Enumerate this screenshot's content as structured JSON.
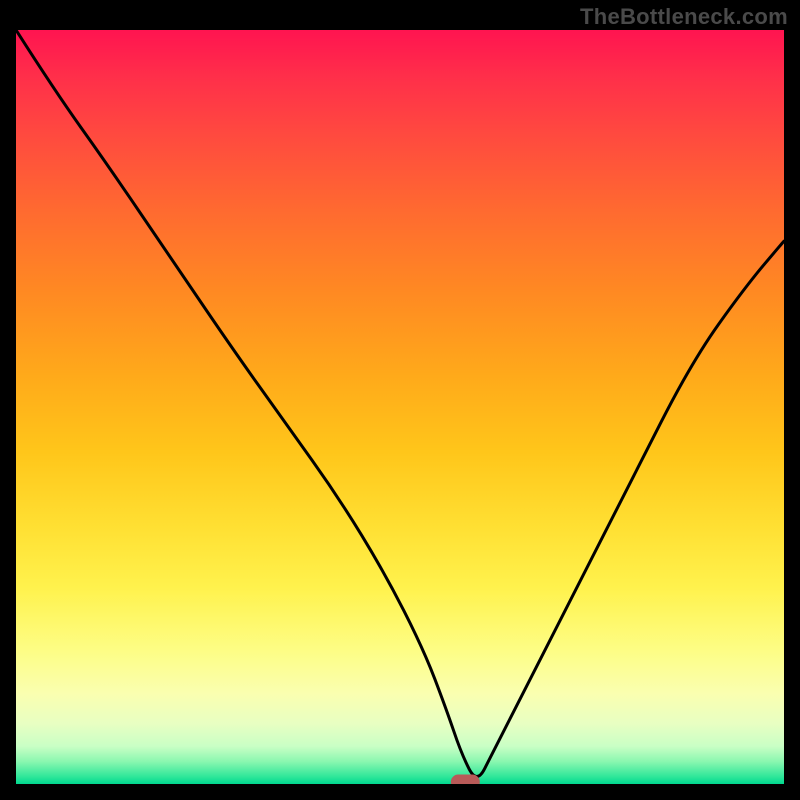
{
  "watermark": "TheBottleneck.com",
  "chart_data": {
    "type": "line",
    "title": "",
    "xlabel": "",
    "ylabel": "",
    "xlim": [
      0,
      100
    ],
    "ylim": [
      0,
      100
    ],
    "grid": false,
    "legend": false,
    "background_gradient": {
      "top": "#ff1450",
      "middle": "#ffd22a",
      "bottom": "#00d88f"
    },
    "series": [
      {
        "name": "bottleneck-curve",
        "x": [
          0,
          5,
          12,
          20,
          28,
          35,
          42,
          48,
          53,
          56,
          58,
          60,
          62,
          66,
          72,
          80,
          88,
          95,
          100
        ],
        "values": [
          100,
          92,
          82,
          70,
          58,
          48,
          38,
          28,
          18,
          10,
          4,
          0,
          4,
          12,
          24,
          40,
          56,
          66,
          72
        ]
      }
    ],
    "marker": {
      "x": 58.5,
      "y": 0,
      "color": "#b85a58"
    },
    "flat_bottom_range": [
      55,
      60
    ]
  }
}
